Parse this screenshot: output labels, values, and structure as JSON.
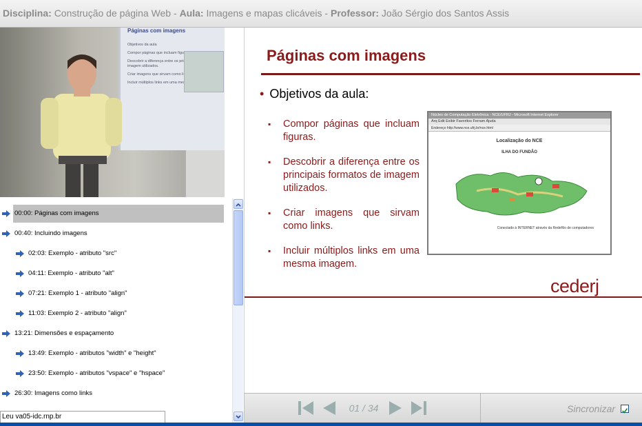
{
  "header": {
    "disciplina_label": "Disciplina:",
    "disciplina": "Construção de página Web",
    "sep1": " - ",
    "aula_label": "Aula:",
    "aula": "Imagens e mapas clicáveis",
    "sep2": " - ",
    "professor_label": "Professor:",
    "professor": "João Sérgio dos Santos Assis"
  },
  "video": {
    "board_title": "Páginas com imagens",
    "board_items": [
      "Objetivos da aula",
      "Compor páginas que incluam figuras.",
      "Descobrir a diferença entre os principais formatos de imagem utilizados.",
      "Criar imagens que sirvam como links.",
      "Incluir múltiplos links em uma mesma imagem."
    ]
  },
  "toc": [
    {
      "time": "00:00",
      "label": "00:00: Páginas com imagens",
      "level": 0,
      "selected": true
    },
    {
      "time": "00:40",
      "label": "00:40: Incluindo imagens",
      "level": 0,
      "selected": false
    },
    {
      "time": "02:03",
      "label": "02:03: Exemplo - atributo \"src\"",
      "level": 1,
      "selected": false
    },
    {
      "time": "04:11",
      "label": "04:11: Exemplo - atributo \"alt\"",
      "level": 1,
      "selected": false
    },
    {
      "time": "07:21",
      "label": "07:21: Exemplo 1 - atributo \"align\"",
      "level": 1,
      "selected": false
    },
    {
      "time": "11:03",
      "label": "11:03: Exemplo 2 - atributo \"align\"",
      "level": 1,
      "selected": false
    },
    {
      "time": "13:21",
      "label": "13:21: Dimensões e espaçamento",
      "level": 0,
      "selected": false
    },
    {
      "time": "13:49",
      "label": "13:49: Exemplo - atributos \"width\" e \"height\"",
      "level": 1,
      "selected": false
    },
    {
      "time": "23:50",
      "label": "23:50: Exemplo - atributos \"vspace\" e \"hspace\"",
      "level": 1,
      "selected": false
    },
    {
      "time": "26:30",
      "label": "26:30: Imagens como links",
      "level": 0,
      "selected": false
    }
  ],
  "status_text": "Leu va05-idc.rnp.br",
  "slide": {
    "title": "Páginas com imagens",
    "objectives": "Objetivos da aula:",
    "bullets": [
      "Compor páginas que incluam figuras.",
      "Descobrir a diferença entre os principais formatos de imagem utilizados.",
      "Criar imagens que sirvam como links.",
      "Incluir múltiplos links em uma mesma imagem."
    ],
    "embedded_browser": {
      "window_title": "Núcleo de Computação Eletrônica - NCE/UFRJ - Microsoft Internet Explorer",
      "menu": "Arq  Edit  Exibir  Favoritos  Ferram  Ajuda",
      "address": "Endereço  http://www.nce.ufrj.br/nce.html",
      "page_title": "Localização do NCE",
      "page_subtitle": "ILHA DO FUNDÃO",
      "footer": "Conectado à INTERNET através da RedeRio de computadores"
    },
    "brand": "cederj"
  },
  "controls": {
    "page_current": "01",
    "page_total": "34",
    "page_text": "01 / 34",
    "sync_label": "Sincronizar",
    "sync_checked": true
  },
  "colors": {
    "slide_accent": "#8b1a1a",
    "toc_arrow": "#2f63b5",
    "control_icon": "#9aaeae",
    "bottom_bar": "#0a4da8"
  }
}
